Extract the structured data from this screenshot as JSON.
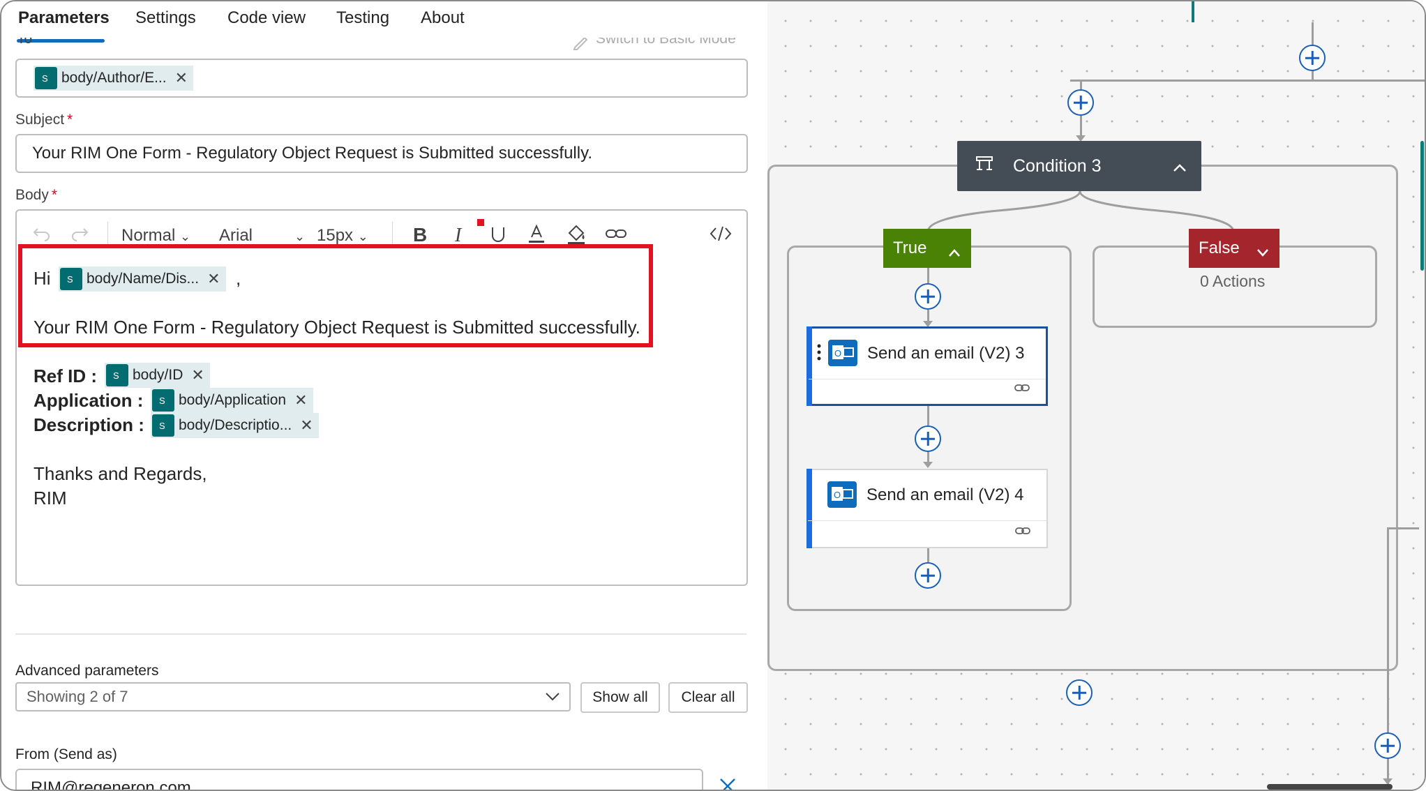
{
  "tabs": [
    "Parameters",
    "Settings",
    "Code view",
    "Testing",
    "About"
  ],
  "to": {
    "label": "To",
    "switch_mode": "Switch to Basic Mode",
    "token": "body/Author/E..."
  },
  "subject": {
    "label": "Subject",
    "required": "*",
    "value": "Your RIM One Form - Regulatory Object Request is Submitted successfully."
  },
  "body": {
    "label": "Body",
    "required": "*",
    "toolbar": {
      "style": "Normal",
      "font": "Arial",
      "size": "15px"
    },
    "greeting": "Hi",
    "greeting_token": "body/Name/Dis...",
    "greeting_comma": ",",
    "line1": "Your RIM One Form - Regulatory Object Request is Submitted successfully.",
    "fields": [
      {
        "label": "Ref ID :",
        "token": "body/ID"
      },
      {
        "label": "Application :",
        "token": "body/Application"
      },
      {
        "label": "Description :",
        "token": "body/Descriptio..."
      }
    ],
    "closing": "Thanks and Regards,",
    "signature": "RIM"
  },
  "advanced": {
    "label": "Advanced parameters",
    "showing": "Showing 2 of 7",
    "show_all": "Show all",
    "clear_all": "Clear all"
  },
  "from": {
    "label": "From (Send as)",
    "value": "RIM@regeneron.com"
  },
  "canvas": {
    "condition": "Condition 3",
    "true_label": "True",
    "false_label": "False",
    "false_actions": "0 Actions",
    "card1": "Send an email (V2) 3",
    "card2": "Send an email (V2) 4"
  },
  "colors": {
    "accent": "#0f6cbd",
    "true": "#498205",
    "false": "#a4262c",
    "condition": "#444c55",
    "highlight": "#e3121e",
    "token_icon": "#036c70"
  }
}
